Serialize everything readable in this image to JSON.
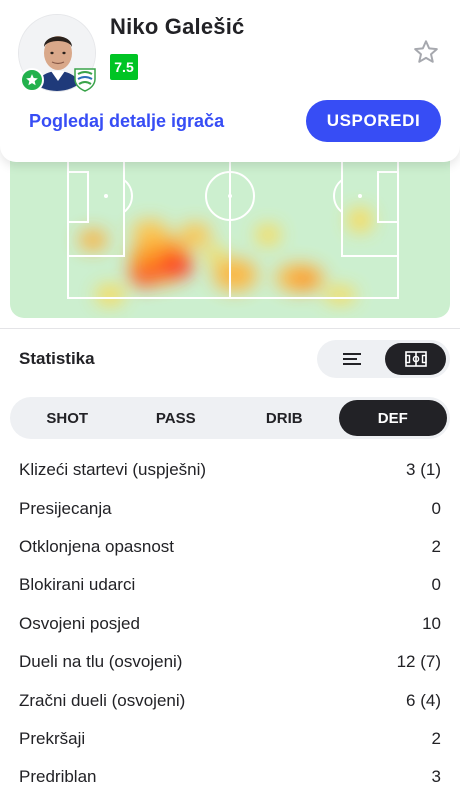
{
  "player": {
    "name": "Niko Galešić",
    "rating": "7.5",
    "rating_color": "#00c424"
  },
  "actions": {
    "details_link": "Pogledaj detalje igrača",
    "compare_button": "USPOREDI"
  },
  "icons": {
    "favorite": "star-outline-icon",
    "badge": "star-badge-icon",
    "club": "club-crest-icon",
    "list_view": "list-icon",
    "field_view": "pitch-icon"
  },
  "colors": {
    "accent": "#374df5",
    "dark": "#222226",
    "pitch": "#ccefcf",
    "heat_high": "#ff3b1f",
    "heat_mid": "#ff9a1e",
    "heat_low": "#ffd84a"
  },
  "stats": {
    "title": "Statistika",
    "tabs": [
      {
        "label": "SHOT",
        "active": false
      },
      {
        "label": "PASS",
        "active": false
      },
      {
        "label": "DRIB",
        "active": false
      },
      {
        "label": "DEF",
        "active": true
      }
    ],
    "rows": [
      {
        "label": "Klizeći startevi (uspješni)",
        "value": "3 (1)"
      },
      {
        "label": "Presijecanja",
        "value": "0"
      },
      {
        "label": "Otklonjena opasnost",
        "value": "2"
      },
      {
        "label": "Blokirani udarci",
        "value": "0"
      },
      {
        "label": "Osvojeni posjed",
        "value": "10"
      },
      {
        "label": "Dueli na tlu (osvojeni)",
        "value": "12 (7)"
      },
      {
        "label": "Zračni dueli (osvojeni)",
        "value": "6 (4)"
      },
      {
        "label": "Prekršaji",
        "value": "2"
      },
      {
        "label": "Predriblan",
        "value": "3"
      }
    ]
  }
}
